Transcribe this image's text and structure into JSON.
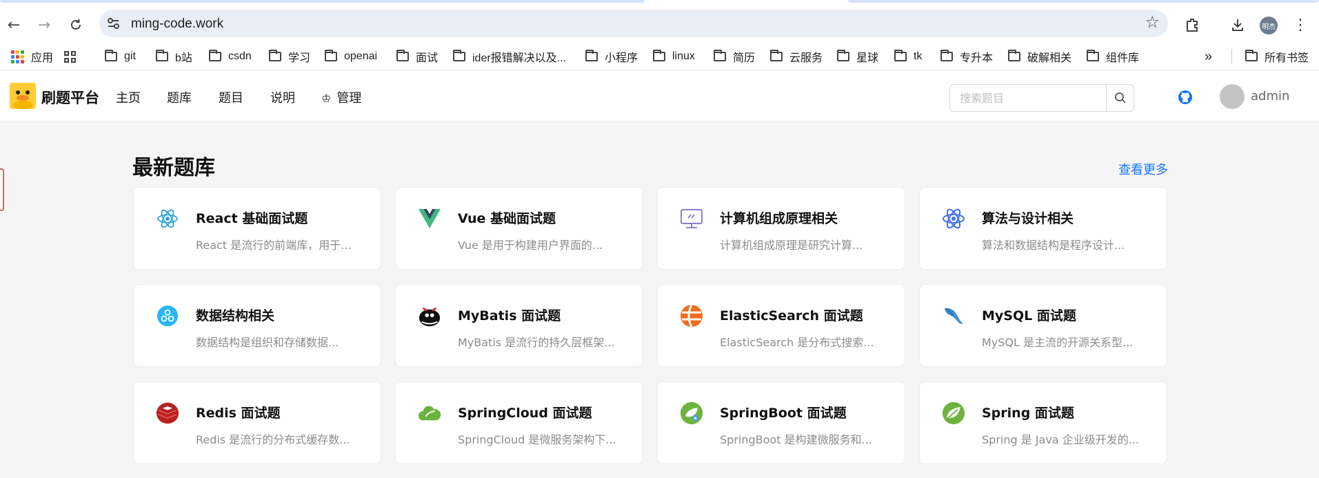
{
  "browser": {
    "url": "ming-code.work",
    "profile_label": "明杰",
    "bookmarks": [
      {
        "label": "应用",
        "type": "apps"
      },
      {
        "label": "",
        "type": "grid"
      },
      {
        "label": "git",
        "type": "folder"
      },
      {
        "label": "b站",
        "type": "folder"
      },
      {
        "label": "csdn",
        "type": "folder"
      },
      {
        "label": "学习",
        "type": "folder"
      },
      {
        "label": "openai",
        "type": "folder"
      },
      {
        "label": "面试",
        "type": "folder"
      },
      {
        "label": "ider报错解决以及...",
        "type": "folder"
      },
      {
        "label": "小程序",
        "type": "folder"
      },
      {
        "label": "linux",
        "type": "folder"
      },
      {
        "label": "简历",
        "type": "folder"
      },
      {
        "label": "云服务",
        "type": "folder"
      },
      {
        "label": "星球",
        "type": "folder"
      },
      {
        "label": "tk",
        "type": "folder"
      },
      {
        "label": "专升本",
        "type": "folder"
      },
      {
        "label": "破解相关",
        "type": "folder"
      },
      {
        "label": "组件库",
        "type": "folder"
      }
    ],
    "bookmarks_overflow": "»",
    "all_bookmarks": "所有书签"
  },
  "site": {
    "logo_title": "刷题平台",
    "menu": [
      "主页",
      "题库",
      "题目",
      "说明"
    ],
    "admin_menu": "管理",
    "search_placeholder": "搜索题目",
    "username": "admin"
  },
  "main": {
    "section_title": "最新题库",
    "more_link": "查看更多",
    "banks": [
      {
        "title": "React 基础面试题",
        "desc": "React 是流行的前端库，用于...",
        "icon": "react-icon"
      },
      {
        "title": "Vue 基础面试题",
        "desc": "Vue 是用于构建用户界面的...",
        "icon": "vue-icon"
      },
      {
        "title": "计算机组成原理相关",
        "desc": "计算机组成原理是研究计算...",
        "icon": "computer-icon"
      },
      {
        "title": "算法与设计相关",
        "desc": "算法和数据结构是程序设计...",
        "icon": "atom-icon"
      },
      {
        "title": "数据结构相关",
        "desc": "数据结构是组织和存储数据...",
        "icon": "data-structure-icon"
      },
      {
        "title": "MyBatis 面试题",
        "desc": "MyBatis 是流行的持久层框架...",
        "icon": "mybatis-icon"
      },
      {
        "title": "ElasticSearch 面试题",
        "desc": "ElasticSearch 是分布式搜索...",
        "icon": "elasticsearch-icon"
      },
      {
        "title": "MySQL 面试题",
        "desc": "MySQL 是主流的开源关系型...",
        "icon": "mysql-icon"
      },
      {
        "title": "Redis 面试题",
        "desc": "Redis 是流行的分布式缓存数...",
        "icon": "redis-icon"
      },
      {
        "title": "SpringCloud 面试题",
        "desc": "SpringCloud 是微服务架构下...",
        "icon": "springcloud-icon"
      },
      {
        "title": "SpringBoot 面试题",
        "desc": "SpringBoot 是构建微服务和...",
        "icon": "springboot-icon"
      },
      {
        "title": "Spring 面试题",
        "desc": "Spring 是 Java 企业级开发的...",
        "icon": "spring-icon"
      }
    ]
  },
  "colors": {
    "accent": "#1677ff",
    "logo_bg": "#ffcc33",
    "github": "#1677ff"
  }
}
